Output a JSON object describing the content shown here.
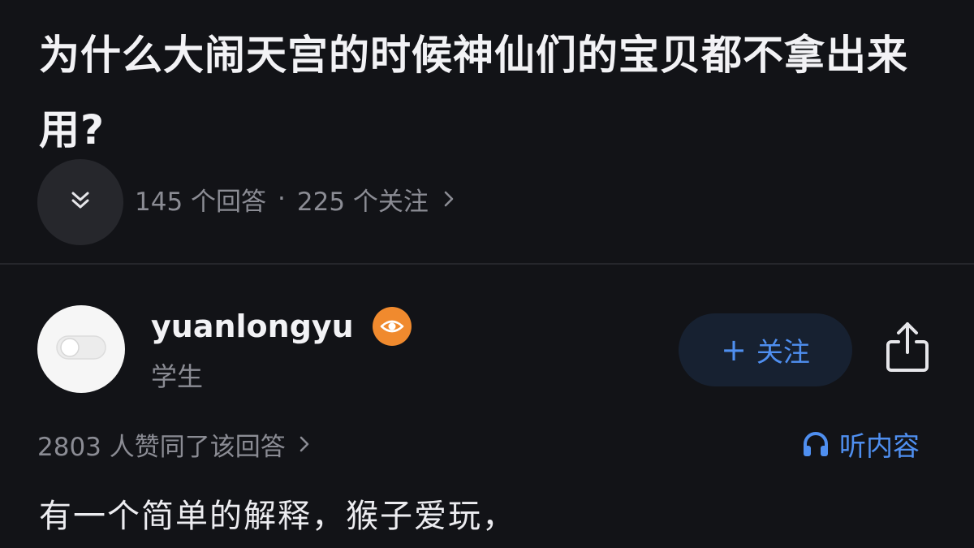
{
  "question": {
    "title": "为什么大闹天宫的时候神仙们的宝贝都不拿出来用?",
    "answer_count": "145 个回答",
    "separator": "·",
    "follower_count": "225 个关注"
  },
  "answer": {
    "author": {
      "name": "yuanlongyu",
      "description": "学生",
      "badge_icon": "eye-icon"
    },
    "follow_button": {
      "plus": "+",
      "label": "关注"
    },
    "vote_summary": "2803 人赞同了该回答",
    "listen_label": "听内容",
    "content_first_line": "有一个简单的解释，猴子爱玩，"
  },
  "colors": {
    "background": "#121317",
    "accent_blue": "#4f8ff0",
    "badge_orange": "#f08a2e",
    "muted_text": "#8b8c94"
  }
}
